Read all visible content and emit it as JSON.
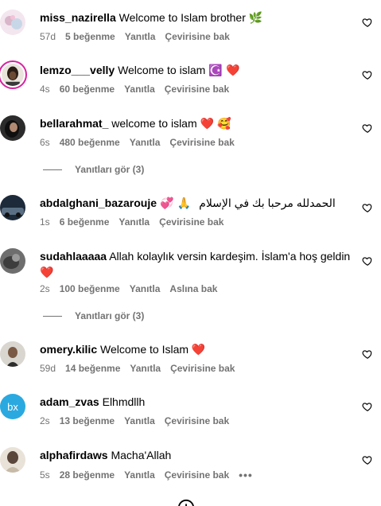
{
  "comments": [
    {
      "username": "miss_nazirella",
      "text": "Welcome to Islam brother",
      "emoji": "🌿",
      "time": "57d",
      "likes": "5 beğenme",
      "reply": "Yanıtla",
      "translate": "Çevirisine bak"
    },
    {
      "username": "lemzo___velly",
      "text": "Welcome to islam",
      "emoji": "☪️ ❤️",
      "time": "4s",
      "likes": "60 beğenme",
      "reply": "Yanıtla",
      "translate": "Çevirisine bak"
    },
    {
      "username": "bellarahmat_",
      "text": "welcome to islam",
      "emoji": "❤️ 🥰",
      "time": "6s",
      "likes": "480 beğenme",
      "reply": "Yanıtla",
      "translate": "Çevirisine bak"
    },
    {
      "username": "abdalghani_bazarouje",
      "text": "الحمدلله مرحبا بك في الإسلام",
      "emoji": "💞 🙏",
      "time": "1s",
      "likes": "6 beğenme",
      "reply": "Yanıtla",
      "translate": "Çevirisine bak"
    },
    {
      "username": "sudahlaaaaa",
      "text": "Allah kolaylık versin kardeşim. İslam'a hoş geldin",
      "emoji": "❤️",
      "time": "2s",
      "likes": "100 beğenme",
      "reply": "Yanıtla",
      "translate": "Aslına bak"
    },
    {
      "username": "omery.kilic",
      "text": "Welcome to Islam",
      "emoji": "❤️",
      "time": "59d",
      "likes": "14 beğenme",
      "reply": "Yanıtla",
      "translate": "Çevirisine bak"
    },
    {
      "username": "adam_zvas",
      "text": "Elhmdllh",
      "emoji": "",
      "time": "2s",
      "likes": "13 beğenme",
      "reply": "Yanıtla",
      "translate": "Çevirisine bak",
      "initials": "bx"
    },
    {
      "username": "alphafirdaws",
      "text": "Macha'Allah",
      "emoji": "",
      "time": "5s",
      "likes": "28 beğenme",
      "reply": "Yanıtla",
      "translate": "Çevirisine bak",
      "more": "•••"
    }
  ],
  "view_replies": [
    "Yanıtları gör (3)",
    "Yanıtları gör (3)"
  ],
  "icons": {
    "like": "heart-outline-icon",
    "more": "more-horizontal-icon",
    "bottom": "add-circle-icon"
  },
  "colors": {
    "meta_text": "#737373",
    "story_ring": "#d6249f",
    "initials_bg": "#2aa9e0"
  }
}
